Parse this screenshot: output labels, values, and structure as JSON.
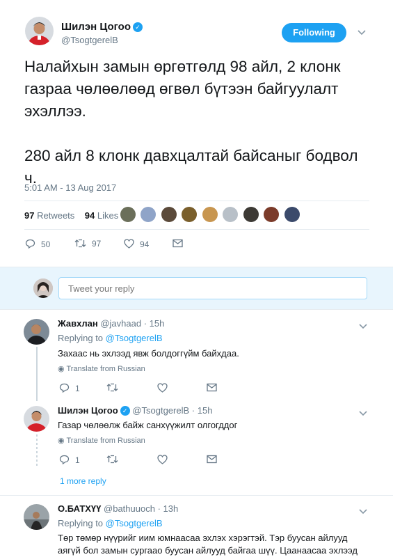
{
  "tweet": {
    "author_name": "Шилэн Цогоо",
    "author_handle": "@TsogtgerelB",
    "follow_label": "Following",
    "text_p1": "Налайхын замын өргөтгөлд 98 айл, 2 клонк газраа чөлөөлөөд өгвөл бүтээн байгуулалт эхэллээ.",
    "text_p2": "280 айл 8 клонк давхцалтай байсаныг бодвол ч.",
    "timestamp": "5:01 AM - 13 Aug 2017",
    "retweets_count": "97",
    "retweets_label": "Retweets",
    "likes_count": "94",
    "likes_label": "Likes",
    "reply_count": "50",
    "retweet_action_count": "97",
    "like_action_count": "94"
  },
  "reply_box": {
    "placeholder": "Tweet your reply"
  },
  "comments": [
    {
      "name": "Жавхлан",
      "handle": "@javhaad",
      "time": "· 15h",
      "replying_prefix": "Replying to",
      "replying_to": "@TsogtgerelB",
      "text": "Захаас нь эхлээд явж болдоггүйм байхдаа.",
      "translate": "Translate from Russian",
      "reply_count": "1"
    },
    {
      "name": "Шилэн Цогоо",
      "handle": "@TsogtgerelB",
      "time": "· 15h",
      "text": "Газар чөлөөлж байж санхүүжилт олгогддог",
      "translate": "Translate from Russian",
      "reply_count": "1"
    },
    {
      "name": "О.БАТХҮҮ",
      "handle": "@bathuuoch",
      "time": "· 13h",
      "replying_prefix": "Replying to",
      "replying_to": "@TsogtgerelB",
      "text": "Төр төмөр нүүрийг иим юмнаасаа эхлэх хэрэгтэй. Тэр буусан айлууд аягүй бол замын сургаао буусан айлууд байгаа шүү. Цаанаасаа эхлээд явчвал"
    }
  ],
  "more_reply_label": "1 more reply",
  "colors": {
    "accent": "#1da1f2",
    "muted": "#657786",
    "reply_bg": "#e8f5fd"
  },
  "icons": [
    "verified-badge-icon",
    "chevron-down-icon",
    "reply-icon",
    "retweet-icon",
    "like-icon",
    "dm-icon",
    "globe-icon"
  ]
}
